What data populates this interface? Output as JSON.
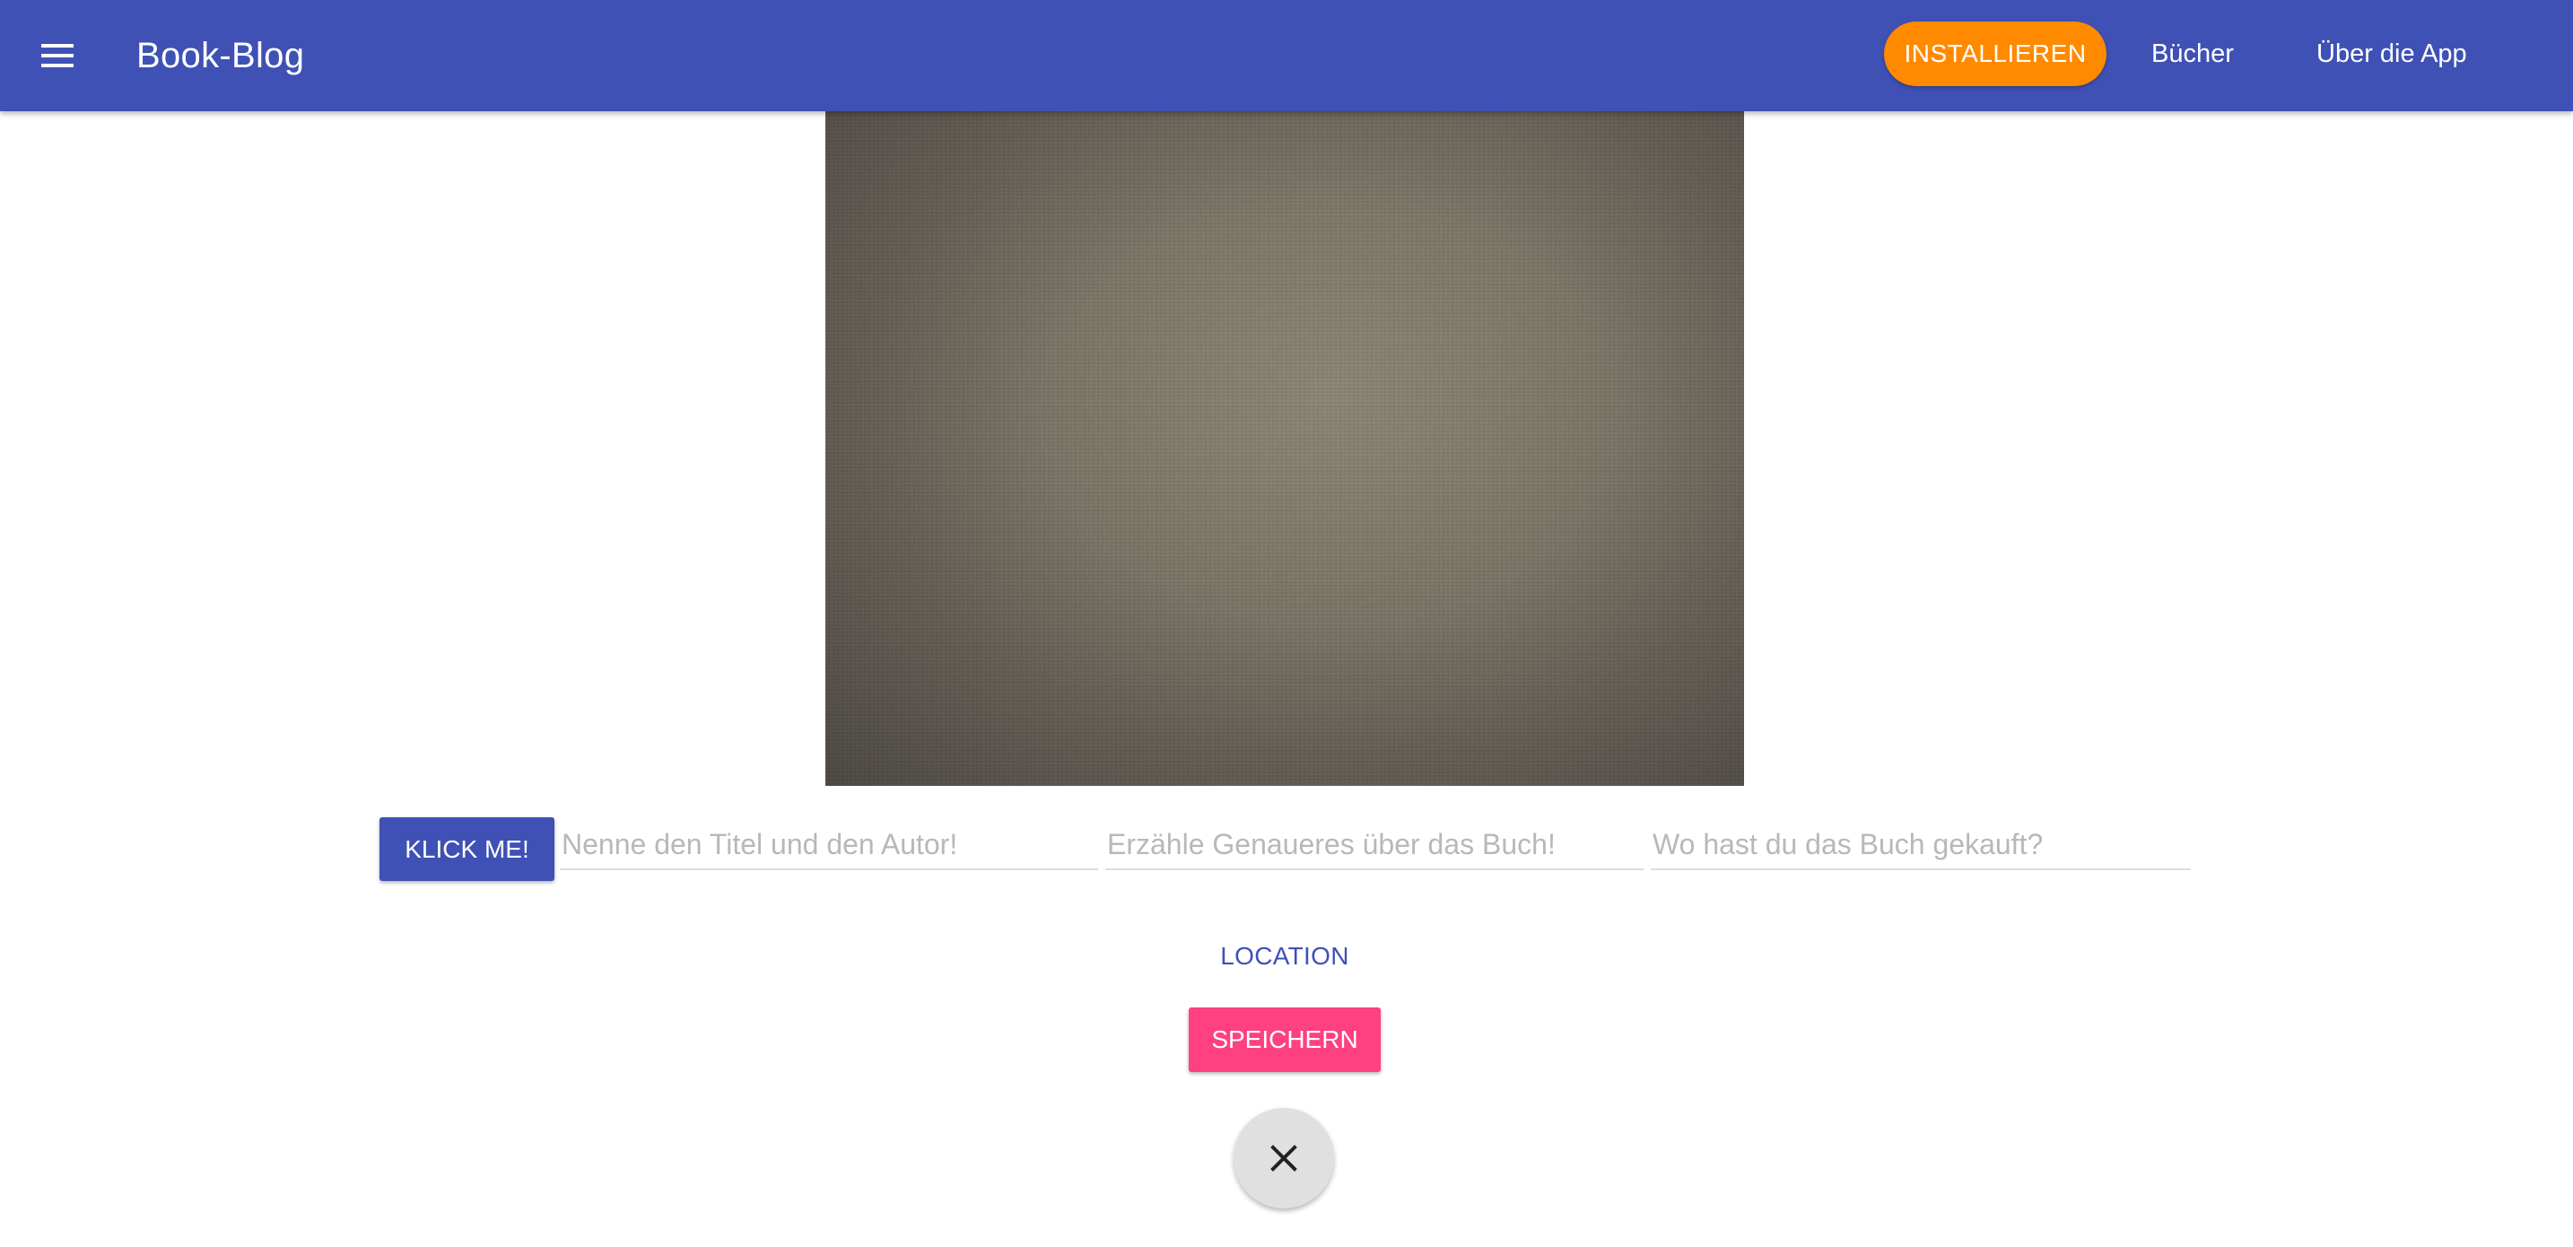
{
  "header": {
    "menu_icon": "menu-icon",
    "title": "Book-Blog",
    "install_label": "INSTALLIEREN",
    "nav": [
      {
        "label": "Bücher"
      },
      {
        "label": "Über die App"
      }
    ],
    "colors": {
      "primary": "#3f51b5",
      "install": "#ff8a00"
    }
  },
  "camera": {
    "preview_icon": "camera-preview"
  },
  "form": {
    "capture_label": "KLICK ME!",
    "title_placeholder": "Nenne den Titel und den Autor!",
    "description_placeholder": "Erzähle Genaueres über das Buch!",
    "location_placeholder": "Wo hast du das Buch gekauft?",
    "location_label": "LOCATION",
    "save_label": "SPEICHERN",
    "close_icon": "close-icon",
    "colors": {
      "save": "#ff4081",
      "location_text": "#3f51b5"
    }
  }
}
